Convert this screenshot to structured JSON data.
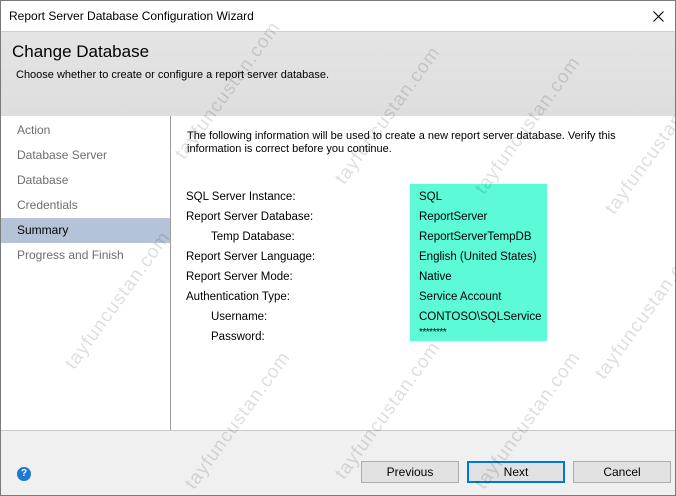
{
  "window": {
    "title": "Report Server Database Configuration Wizard"
  },
  "header": {
    "title": "Change Database",
    "subtitle": "Choose whether to create or configure a report server database."
  },
  "sidebar": {
    "items": [
      {
        "label": "Action"
      },
      {
        "label": "Database Server"
      },
      {
        "label": "Database"
      },
      {
        "label": "Credentials"
      },
      {
        "label": "Summary"
      },
      {
        "label": "Progress and Finish"
      }
    ],
    "selected": "Summary"
  },
  "summary": {
    "intro": "The following information will be used to create a new report server database. Verify this information is correct before you continue.",
    "rows": [
      {
        "label": "SQL Server Instance:",
        "value": "SQL"
      },
      {
        "label": "Report Server Database:",
        "value": "ReportServer"
      },
      {
        "label": "Temp Database:",
        "value": "ReportServerTempDB"
      },
      {
        "label": "Report Server Language:",
        "value": "English (United States)"
      },
      {
        "label": "Report Server Mode:",
        "value": "Native"
      },
      {
        "label": "Authentication Type:",
        "value": "Service Account"
      },
      {
        "label": "Username:",
        "value": "CONTOSO\\SQLService"
      },
      {
        "label": "Password:",
        "value": "********"
      }
    ]
  },
  "footer": {
    "help_icon": "help-icon",
    "previous_label": "Previous",
    "next_label": "Next",
    "cancel_label": "Cancel"
  },
  "watermark": "tayfuncustan.com",
  "colors": {
    "highlight": "#5cfad6",
    "selected_nav": "#b5c3d9",
    "default_button_border": "#0078d7"
  }
}
